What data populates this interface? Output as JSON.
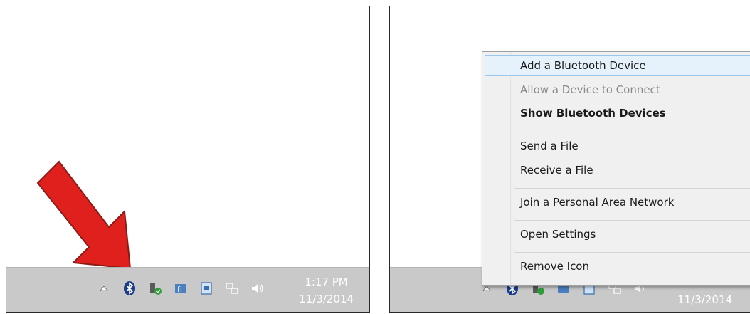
{
  "left_panel": {
    "clock": {
      "time": "1:17 PM",
      "date": "11/3/2014"
    },
    "tray_icons": [
      "chevron-up-icon",
      "bluetooth-icon",
      "power-usb-icon",
      "network-share-icon",
      "monitor-icon",
      "network-icon",
      "speaker-icon"
    ],
    "arrow_color": "#e0201c"
  },
  "right_panel": {
    "context_menu": {
      "items": [
        {
          "label": "Add a Bluetooth Device",
          "state": "highlighted"
        },
        {
          "label": "Allow a Device to Connect",
          "state": "disabled"
        },
        {
          "label": "Show Bluetooth Devices",
          "state": "bold"
        },
        {
          "label": "Send a File",
          "state": "normal"
        },
        {
          "label": "Receive a File",
          "state": "normal"
        },
        {
          "label": "Join a Personal Area Network",
          "state": "normal"
        },
        {
          "label": "Open Settings",
          "state": "normal"
        },
        {
          "label": "Remove Icon",
          "state": "normal"
        }
      ]
    },
    "clock": {
      "date": "11/3/2014"
    }
  },
  "colors": {
    "taskbar": "#c9c9c9",
    "menu_highlight": "#e5f1fb",
    "menu_highlight_border": "#99c7ef"
  }
}
